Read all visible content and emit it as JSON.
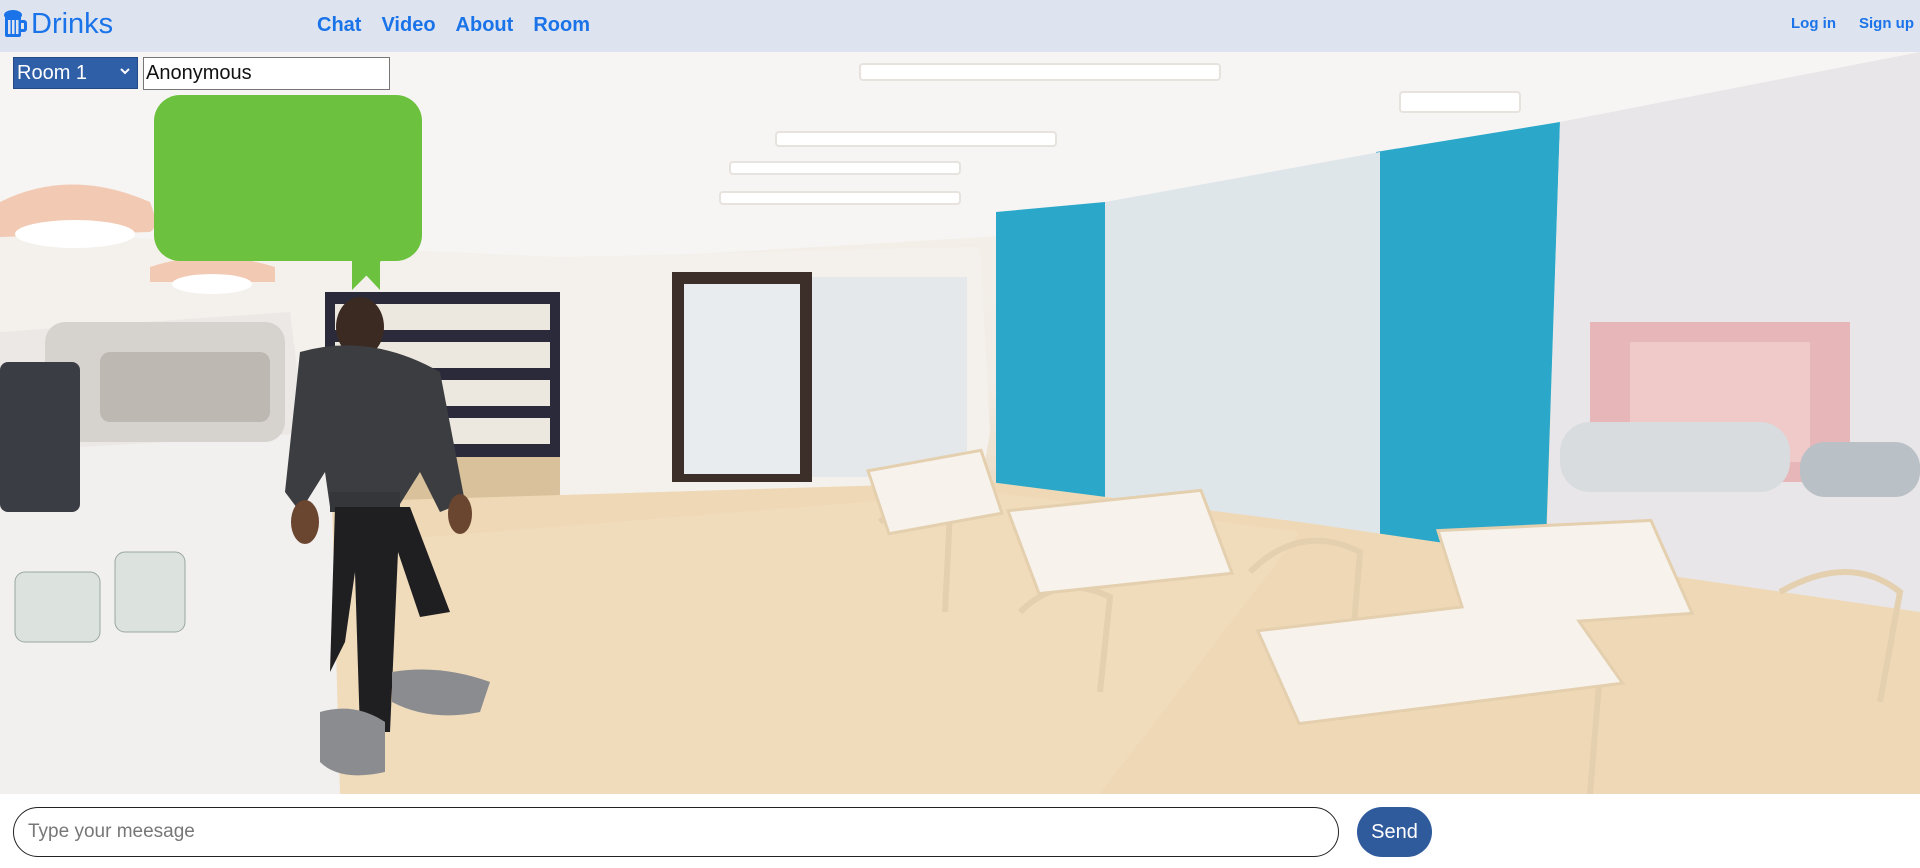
{
  "header": {
    "brand": "Drinks",
    "nav": [
      "Chat",
      "Video",
      "About",
      "Room"
    ],
    "login": "Log in",
    "signup": "Sign up"
  },
  "room": {
    "selected": "Room 1",
    "options": [
      "Room 1"
    ]
  },
  "name_input": {
    "value": "Anonymous"
  },
  "chat": {
    "placeholder": "Type your meesage",
    "send_label": "Send"
  },
  "colors": {
    "header_bg": "#dde4f0",
    "link": "#1a73e8",
    "select_bg": "#2f5fa7",
    "bubble": "#6cc23f",
    "send_bg": "#2f5a9c",
    "accent_wall": "#2aa7c9"
  },
  "icons": {
    "brand": "beer-mug-icon"
  }
}
